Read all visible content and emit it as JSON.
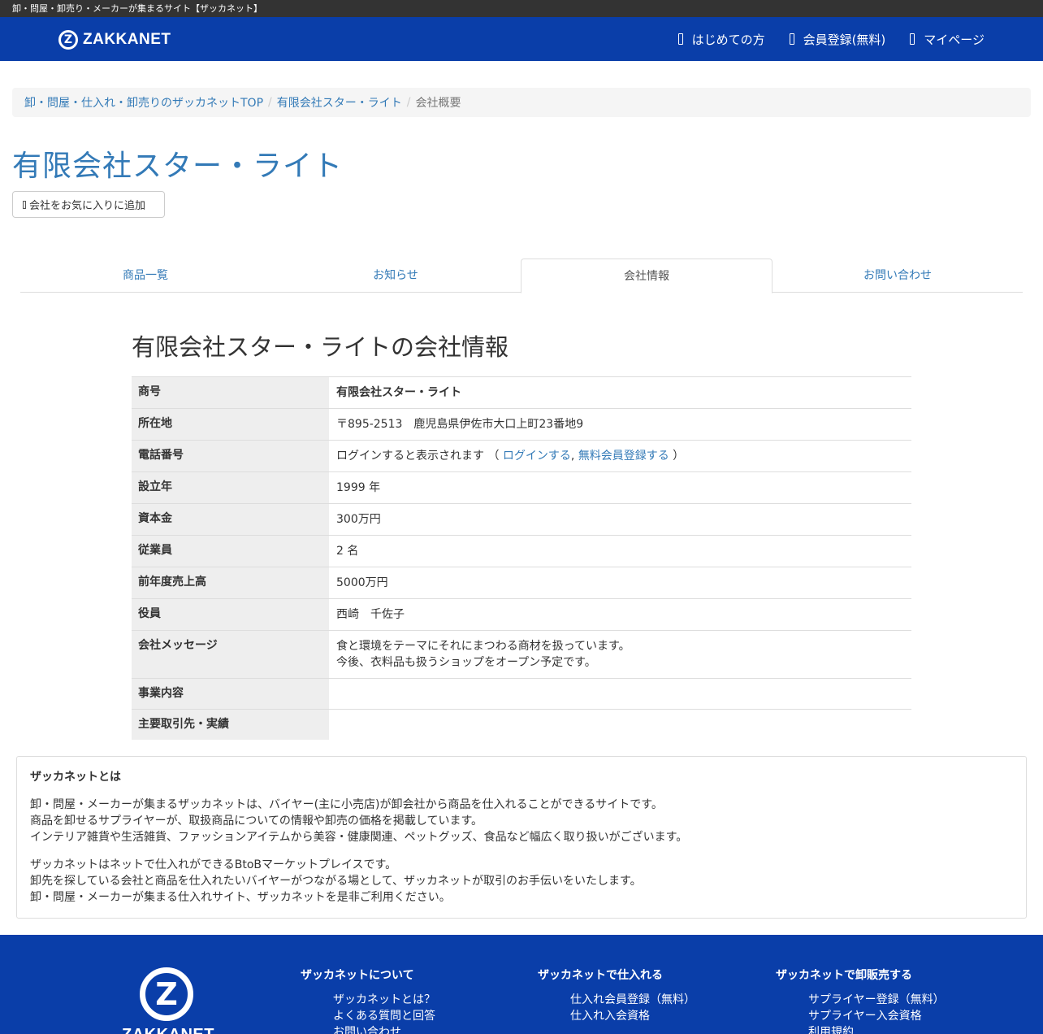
{
  "header": {
    "tagline": "卸・問屋・卸売り・メーカーが集まるサイト【ザッカネット】",
    "logo_text": "ZAKKANET",
    "nav": [
      {
        "label": "はじめての方"
      },
      {
        "label": "会員登録(無料)"
      },
      {
        "label": "マイページ"
      }
    ]
  },
  "breadcrumb": {
    "items": [
      "卸・問屋・仕入れ・卸売りのザッカネットTOP",
      "有限会社スター・ライト",
      "会社概要"
    ]
  },
  "company": {
    "name": "有限会社スター・ライト",
    "favorite_button": "会社をお気に入りに追加"
  },
  "tabs": [
    {
      "label": "商品一覧"
    },
    {
      "label": "お知らせ"
    },
    {
      "label": "会社情報"
    },
    {
      "label": "お問い合わせ"
    }
  ],
  "info": {
    "title": "有限会社スター・ライトの会社情報",
    "rows": {
      "trade_name": {
        "label": "商号",
        "value": "有限会社スター・ライト"
      },
      "address": {
        "label": "所在地",
        "value": "〒895‐2513　鹿児島県伊佐市大口上町23番地9"
      },
      "phone": {
        "label": "電話番号",
        "prefix": "ログインすると表示されます （",
        "login_link": "ログインする",
        "comma": ",",
        "register_link": "無料会員登録する",
        "suffix": "）"
      },
      "founded": {
        "label": "設立年",
        "value": "1999 年"
      },
      "capital": {
        "label": "資本金",
        "value": "300万円"
      },
      "employees": {
        "label": "従業員",
        "value": "2 名"
      },
      "sales": {
        "label": "前年度売上高",
        "value": "5000万円"
      },
      "officers": {
        "label": "役員",
        "value": "西崎　千佐子"
      },
      "message": {
        "label": "会社メッセージ",
        "line1": "食と環境をテーマにそれにまつわる商材を扱っています。",
        "line2": "今後、衣料品も扱うショップをオープン予定です。"
      },
      "business": {
        "label": "事業内容",
        "value": ""
      },
      "partners": {
        "label": "主要取引先・実績",
        "value": ""
      }
    }
  },
  "about": {
    "title": "ザッカネットとは",
    "p1": [
      "卸・問屋・メーカーが集まるザッカネットは、バイヤー(主に小売店)が卸会社から商品を仕入れることができるサイトです。",
      "商品を卸せるサプライヤーが、取扱商品についての情報や卸売の価格を掲載しています。",
      "インテリア雑貨や生活雑貨、ファッションアイテムから美容・健康関連、ペットグッズ、食品など幅広く取り扱いがございます。"
    ],
    "p2": [
      "ザッカネットはネットで仕入れができるBtoBマーケットプレイスです。",
      "卸先を探している会社と商品を仕入れたいバイヤーがつながる場として、ザッカネットが取引のお手伝いをいたします。",
      "卸・問屋・メーカーが集まる仕入れサイト、ザッカネットを是非ご利用ください。"
    ]
  },
  "footer": {
    "logo_text": "ZAKKANET",
    "columns": [
      {
        "title": "ザッカネットについて",
        "links": [
          "ザッカネットとは？",
          "よくある質問と回答",
          "お問い合わせ"
        ]
      },
      {
        "title": "ザッカネットで仕入れる",
        "links": [
          "仕入れ会員登録（無料）",
          "仕入れ入会資格"
        ]
      },
      {
        "title": "ザッカネットで卸販売する",
        "links": [
          "サプライヤー登録（無料）",
          "サプライヤー入会資格",
          "利用規約"
        ]
      }
    ]
  },
  "colors": {
    "brand": "#0a3ea9",
    "link": "#337ab7"
  }
}
